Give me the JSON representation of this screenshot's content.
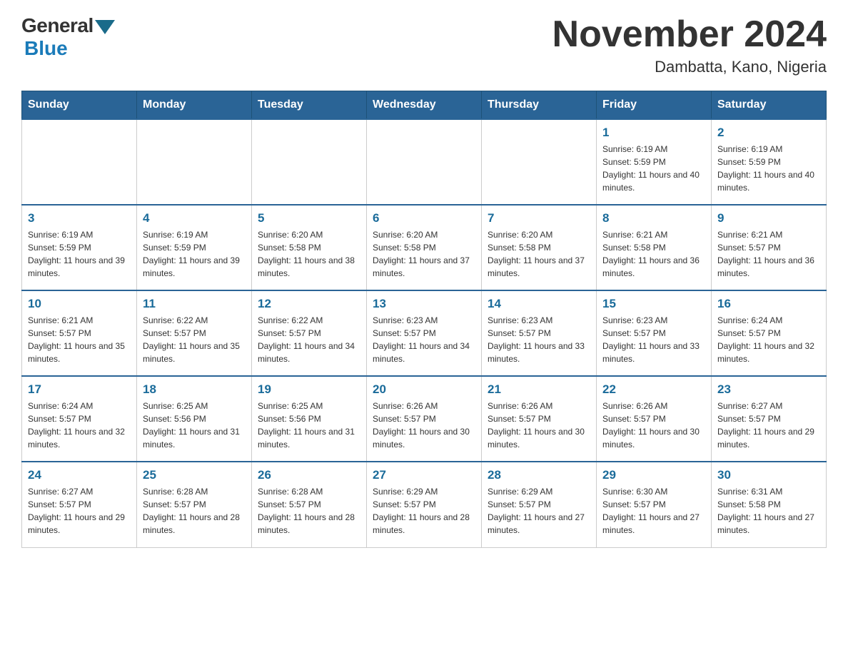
{
  "header": {
    "logo_general": "General",
    "logo_blue": "Blue",
    "month_year": "November 2024",
    "location": "Dambatta, Kano, Nigeria"
  },
  "days_of_week": [
    "Sunday",
    "Monday",
    "Tuesday",
    "Wednesday",
    "Thursday",
    "Friday",
    "Saturday"
  ],
  "weeks": [
    [
      {
        "day": "",
        "sunrise": "",
        "sunset": "",
        "daylight": ""
      },
      {
        "day": "",
        "sunrise": "",
        "sunset": "",
        "daylight": ""
      },
      {
        "day": "",
        "sunrise": "",
        "sunset": "",
        "daylight": ""
      },
      {
        "day": "",
        "sunrise": "",
        "sunset": "",
        "daylight": ""
      },
      {
        "day": "",
        "sunrise": "",
        "sunset": "",
        "daylight": ""
      },
      {
        "day": "1",
        "sunrise": "Sunrise: 6:19 AM",
        "sunset": "Sunset: 5:59 PM",
        "daylight": "Daylight: 11 hours and 40 minutes."
      },
      {
        "day": "2",
        "sunrise": "Sunrise: 6:19 AM",
        "sunset": "Sunset: 5:59 PM",
        "daylight": "Daylight: 11 hours and 40 minutes."
      }
    ],
    [
      {
        "day": "3",
        "sunrise": "Sunrise: 6:19 AM",
        "sunset": "Sunset: 5:59 PM",
        "daylight": "Daylight: 11 hours and 39 minutes."
      },
      {
        "day": "4",
        "sunrise": "Sunrise: 6:19 AM",
        "sunset": "Sunset: 5:59 PM",
        "daylight": "Daylight: 11 hours and 39 minutes."
      },
      {
        "day": "5",
        "sunrise": "Sunrise: 6:20 AM",
        "sunset": "Sunset: 5:58 PM",
        "daylight": "Daylight: 11 hours and 38 minutes."
      },
      {
        "day": "6",
        "sunrise": "Sunrise: 6:20 AM",
        "sunset": "Sunset: 5:58 PM",
        "daylight": "Daylight: 11 hours and 37 minutes."
      },
      {
        "day": "7",
        "sunrise": "Sunrise: 6:20 AM",
        "sunset": "Sunset: 5:58 PM",
        "daylight": "Daylight: 11 hours and 37 minutes."
      },
      {
        "day": "8",
        "sunrise": "Sunrise: 6:21 AM",
        "sunset": "Sunset: 5:58 PM",
        "daylight": "Daylight: 11 hours and 36 minutes."
      },
      {
        "day": "9",
        "sunrise": "Sunrise: 6:21 AM",
        "sunset": "Sunset: 5:57 PM",
        "daylight": "Daylight: 11 hours and 36 minutes."
      }
    ],
    [
      {
        "day": "10",
        "sunrise": "Sunrise: 6:21 AM",
        "sunset": "Sunset: 5:57 PM",
        "daylight": "Daylight: 11 hours and 35 minutes."
      },
      {
        "day": "11",
        "sunrise": "Sunrise: 6:22 AM",
        "sunset": "Sunset: 5:57 PM",
        "daylight": "Daylight: 11 hours and 35 minutes."
      },
      {
        "day": "12",
        "sunrise": "Sunrise: 6:22 AM",
        "sunset": "Sunset: 5:57 PM",
        "daylight": "Daylight: 11 hours and 34 minutes."
      },
      {
        "day": "13",
        "sunrise": "Sunrise: 6:23 AM",
        "sunset": "Sunset: 5:57 PM",
        "daylight": "Daylight: 11 hours and 34 minutes."
      },
      {
        "day": "14",
        "sunrise": "Sunrise: 6:23 AM",
        "sunset": "Sunset: 5:57 PM",
        "daylight": "Daylight: 11 hours and 33 minutes."
      },
      {
        "day": "15",
        "sunrise": "Sunrise: 6:23 AM",
        "sunset": "Sunset: 5:57 PM",
        "daylight": "Daylight: 11 hours and 33 minutes."
      },
      {
        "day": "16",
        "sunrise": "Sunrise: 6:24 AM",
        "sunset": "Sunset: 5:57 PM",
        "daylight": "Daylight: 11 hours and 32 minutes."
      }
    ],
    [
      {
        "day": "17",
        "sunrise": "Sunrise: 6:24 AM",
        "sunset": "Sunset: 5:57 PM",
        "daylight": "Daylight: 11 hours and 32 minutes."
      },
      {
        "day": "18",
        "sunrise": "Sunrise: 6:25 AM",
        "sunset": "Sunset: 5:56 PM",
        "daylight": "Daylight: 11 hours and 31 minutes."
      },
      {
        "day": "19",
        "sunrise": "Sunrise: 6:25 AM",
        "sunset": "Sunset: 5:56 PM",
        "daylight": "Daylight: 11 hours and 31 minutes."
      },
      {
        "day": "20",
        "sunrise": "Sunrise: 6:26 AM",
        "sunset": "Sunset: 5:57 PM",
        "daylight": "Daylight: 11 hours and 30 minutes."
      },
      {
        "day": "21",
        "sunrise": "Sunrise: 6:26 AM",
        "sunset": "Sunset: 5:57 PM",
        "daylight": "Daylight: 11 hours and 30 minutes."
      },
      {
        "day": "22",
        "sunrise": "Sunrise: 6:26 AM",
        "sunset": "Sunset: 5:57 PM",
        "daylight": "Daylight: 11 hours and 30 minutes."
      },
      {
        "day": "23",
        "sunrise": "Sunrise: 6:27 AM",
        "sunset": "Sunset: 5:57 PM",
        "daylight": "Daylight: 11 hours and 29 minutes."
      }
    ],
    [
      {
        "day": "24",
        "sunrise": "Sunrise: 6:27 AM",
        "sunset": "Sunset: 5:57 PM",
        "daylight": "Daylight: 11 hours and 29 minutes."
      },
      {
        "day": "25",
        "sunrise": "Sunrise: 6:28 AM",
        "sunset": "Sunset: 5:57 PM",
        "daylight": "Daylight: 11 hours and 28 minutes."
      },
      {
        "day": "26",
        "sunrise": "Sunrise: 6:28 AM",
        "sunset": "Sunset: 5:57 PM",
        "daylight": "Daylight: 11 hours and 28 minutes."
      },
      {
        "day": "27",
        "sunrise": "Sunrise: 6:29 AM",
        "sunset": "Sunset: 5:57 PM",
        "daylight": "Daylight: 11 hours and 28 minutes."
      },
      {
        "day": "28",
        "sunrise": "Sunrise: 6:29 AM",
        "sunset": "Sunset: 5:57 PM",
        "daylight": "Daylight: 11 hours and 27 minutes."
      },
      {
        "day": "29",
        "sunrise": "Sunrise: 6:30 AM",
        "sunset": "Sunset: 5:57 PM",
        "daylight": "Daylight: 11 hours and 27 minutes."
      },
      {
        "day": "30",
        "sunrise": "Sunrise: 6:31 AM",
        "sunset": "Sunset: 5:58 PM",
        "daylight": "Daylight: 11 hours and 27 minutes."
      }
    ]
  ]
}
